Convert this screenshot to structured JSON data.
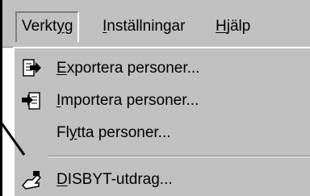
{
  "menubar": {
    "items": [
      {
        "label": "Verktyg",
        "mnemonic": "y",
        "state": "open"
      },
      {
        "label": "Inställningar",
        "mnemonic": "I"
      },
      {
        "label": "Hjälp",
        "mnemonic": "H"
      }
    ]
  },
  "dropdown": {
    "items": [
      {
        "label": "Exportera personer...",
        "icon": "export-icon"
      },
      {
        "label": "Importera personer...",
        "icon": "import-icon"
      },
      {
        "label": "Flytta personer..."
      },
      {
        "label": "DISBYT-utdrag...",
        "icon": "disbyt-hand-icon"
      }
    ]
  }
}
